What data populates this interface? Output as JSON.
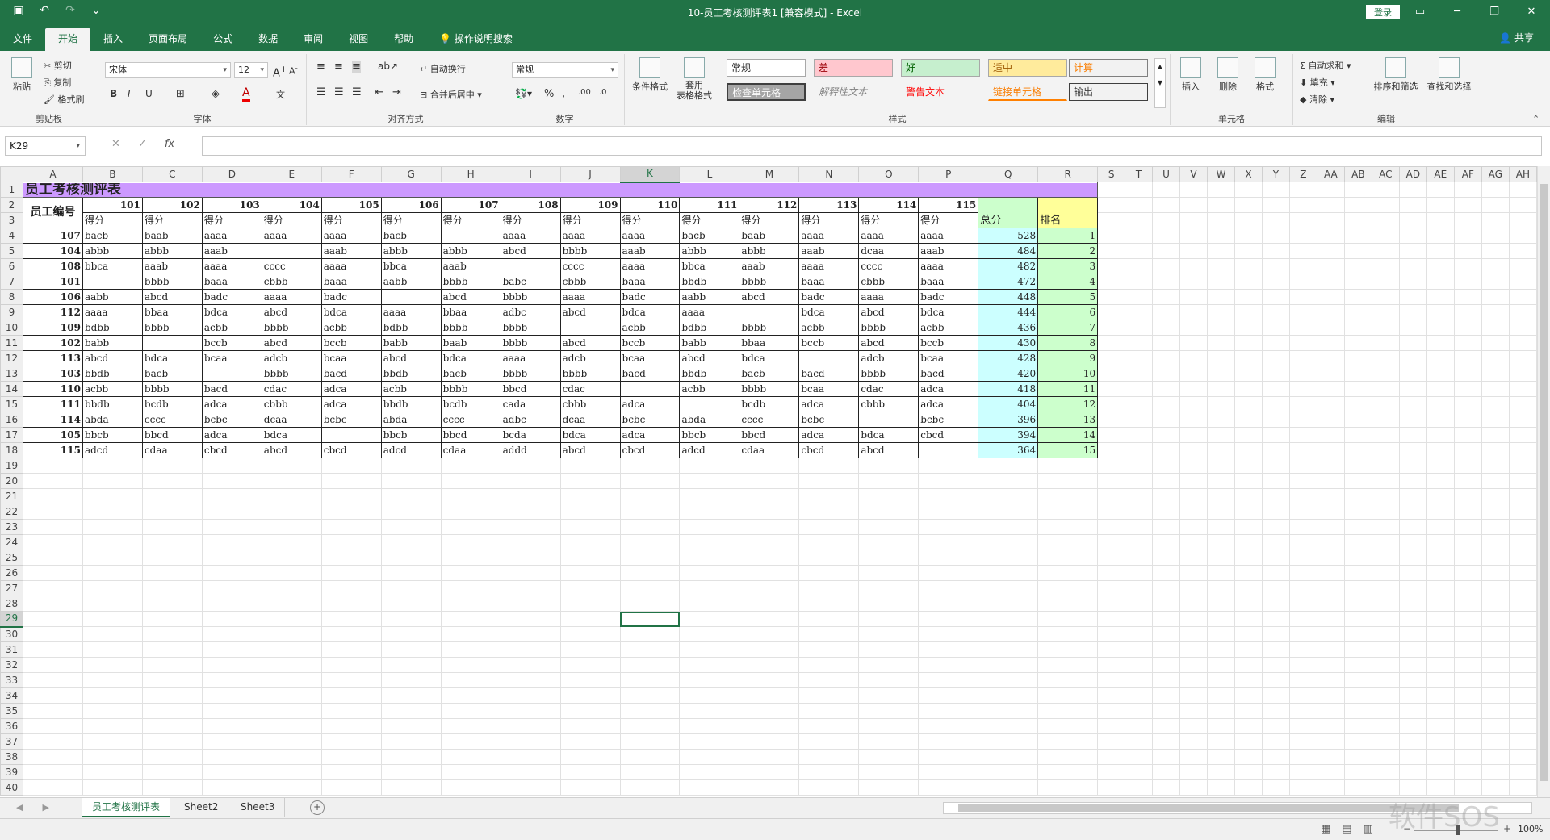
{
  "window": {
    "title": "10-员工考核测评表1  [兼容模式]  -  Excel",
    "login": "登录",
    "share": "共享"
  },
  "ribbon_tabs": [
    "文件",
    "开始",
    "插入",
    "页面布局",
    "公式",
    "数据",
    "审阅",
    "视图",
    "帮助"
  ],
  "tell_me": "操作说明搜索",
  "ribbon": {
    "clipboard": {
      "paste": "粘贴",
      "cut": "剪切",
      "copy": "复制",
      "format_painter": "格式刷",
      "label": "剪贴板"
    },
    "font": {
      "name": "宋体",
      "size": "12",
      "bold": "B",
      "italic": "I",
      "underline": "U",
      "label": "字体"
    },
    "alignment": {
      "wrap": "自动换行",
      "merge": "合并后居中",
      "label": "对齐方式"
    },
    "number": {
      "format": "常规",
      "percent": "%",
      "label": "数字"
    },
    "styles": {
      "conditional": "条件格式",
      "table": "套用\n表格格式",
      "cells": [
        "常规",
        "差",
        "好",
        "适中",
        "计算",
        "检查单元格",
        "解释性文本",
        "警告文本",
        "链接单元格",
        "输出"
      ],
      "label": "样式"
    },
    "cells_group": {
      "insert": "插入",
      "delete": "删除",
      "format": "格式",
      "label": "单元格"
    },
    "editing": {
      "autosum": "自动求和",
      "fill": "填充",
      "clear": "清除",
      "sort": "排序和筛选",
      "find": "查找和选择",
      "label": "编辑"
    }
  },
  "formula_bar": {
    "name_box": "K29",
    "fx": "fx",
    "content": ""
  },
  "columns": [
    "A",
    "B",
    "C",
    "D",
    "E",
    "F",
    "G",
    "H",
    "I",
    "J",
    "K",
    "L",
    "M",
    "N",
    "O",
    "P",
    "Q",
    "R",
    "S",
    "T",
    "U",
    "V",
    "W",
    "X",
    "Y",
    "Z",
    "AA",
    "AB",
    "AC",
    "AD",
    "AE",
    "AF",
    "AG",
    "AH"
  ],
  "sheet": {
    "title": "员工考核测评表",
    "emp_header": "员工编号",
    "project_ids": [
      "101",
      "102",
      "103",
      "104",
      "105",
      "106",
      "107",
      "108",
      "109",
      "110",
      "111",
      "112",
      "113",
      "114",
      "115"
    ],
    "score_label": "得分",
    "total_header": "总分",
    "rank_header": "排名",
    "rows": [
      {
        "id": "107",
        "s": [
          "bacb",
          "baab",
          "aaaa",
          "aaaa",
          "aaaa",
          "bacb",
          "",
          "aaaa",
          "aaaa",
          "aaaa",
          "bacb",
          "baab",
          "aaaa",
          "aaaa",
          "aaaa"
        ],
        "total": "528",
        "rank": "1"
      },
      {
        "id": "104",
        "s": [
          "abbb",
          "abbb",
          "aaab",
          "",
          "aaab",
          "abbb",
          "abbb",
          "abcd",
          "bbbb",
          "aaab",
          "abbb",
          "abbb",
          "aaab",
          "dcaa",
          "aaab"
        ],
        "total": "484",
        "rank": "2"
      },
      {
        "id": "108",
        "s": [
          "bbca",
          "aaab",
          "aaaa",
          "cccc",
          "aaaa",
          "bbca",
          "aaab",
          "",
          "cccc",
          "aaaa",
          "bbca",
          "aaab",
          "aaaa",
          "cccc",
          "aaaa"
        ],
        "total": "482",
        "rank": "3"
      },
      {
        "id": "101",
        "s": [
          "",
          "bbbb",
          "baaa",
          "cbbb",
          "baaa",
          "aabb",
          "bbbb",
          "babc",
          "cbbb",
          "baaa",
          "bbdb",
          "bbbb",
          "baaa",
          "cbbb",
          "baaa"
        ],
        "total": "472",
        "rank": "4"
      },
      {
        "id": "106",
        "s": [
          "aabb",
          "abcd",
          "badc",
          "aaaa",
          "badc",
          "",
          "abcd",
          "bbbb",
          "aaaa",
          "badc",
          "aabb",
          "abcd",
          "badc",
          "aaaa",
          "badc"
        ],
        "total": "448",
        "rank": "5"
      },
      {
        "id": "112",
        "s": [
          "aaaa",
          "bbaa",
          "bdca",
          "abcd",
          "bdca",
          "aaaa",
          "bbaa",
          "adbc",
          "abcd",
          "bdca",
          "aaaa",
          "",
          "bdca",
          "abcd",
          "bdca"
        ],
        "total": "444",
        "rank": "6"
      },
      {
        "id": "109",
        "s": [
          "bdbb",
          "bbbb",
          "acbb",
          "bbbb",
          "acbb",
          "bdbb",
          "bbbb",
          "bbbb",
          "",
          "acbb",
          "bdbb",
          "bbbb",
          "acbb",
          "bbbb",
          "acbb"
        ],
        "total": "436",
        "rank": "7"
      },
      {
        "id": "102",
        "s": [
          "babb",
          "",
          "bccb",
          "abcd",
          "bccb",
          "babb",
          "baab",
          "bbbb",
          "abcd",
          "bccb",
          "babb",
          "bbaa",
          "bccb",
          "abcd",
          "bccb"
        ],
        "total": "430",
        "rank": "8"
      },
      {
        "id": "113",
        "s": [
          "abcd",
          "bdca",
          "bcaa",
          "adcb",
          "bcaa",
          "abcd",
          "bdca",
          "aaaa",
          "adcb",
          "bcaa",
          "abcd",
          "bdca",
          "",
          "adcb",
          "bcaa"
        ],
        "total": "428",
        "rank": "9"
      },
      {
        "id": "103",
        "s": [
          "bbdb",
          "bacb",
          "",
          "bbbb",
          "bacd",
          "bbdb",
          "bacb",
          "bbbb",
          "bbbb",
          "bacd",
          "bbdb",
          "bacb",
          "bacd",
          "bbbb",
          "bacd"
        ],
        "total": "420",
        "rank": "10"
      },
      {
        "id": "110",
        "s": [
          "acbb",
          "bbbb",
          "bacd",
          "cdac",
          "adca",
          "acbb",
          "bbbb",
          "bbcd",
          "cdac",
          "",
          "acbb",
          "bbbb",
          "bcaa",
          "cdac",
          "adca"
        ],
        "total": "418",
        "rank": "11"
      },
      {
        "id": "111",
        "s": [
          "bbdb",
          "bcdb",
          "adca",
          "cbbb",
          "adca",
          "bbdb",
          "bcdb",
          "cada",
          "cbbb",
          "adca",
          "",
          "bcdb",
          "adca",
          "cbbb",
          "adca"
        ],
        "total": "404",
        "rank": "12"
      },
      {
        "id": "114",
        "s": [
          "abda",
          "cccc",
          "bcbc",
          "dcaa",
          "bcbc",
          "abda",
          "cccc",
          "adbc",
          "dcaa",
          "bcbc",
          "abda",
          "cccc",
          "bcbc",
          "",
          "bcbc"
        ],
        "total": "396",
        "rank": "13"
      },
      {
        "id": "105",
        "s": [
          "bbcb",
          "bbcd",
          "adca",
          "bdca",
          "",
          "bbcb",
          "bbcd",
          "bcda",
          "bdca",
          "adca",
          "bbcb",
          "bbcd",
          "adca",
          "bdca",
          "cbcd"
        ],
        "total": "394",
        "rank": "14"
      },
      {
        "id": "115",
        "s": [
          "adcd",
          "cdaa",
          "cbcd",
          "abcd",
          "cbcd",
          "adcd",
          "cdaa",
          "addd",
          "abcd",
          "cbcd",
          "adcd",
          "cdaa",
          "cbcd",
          "abcd",
          ""
        ],
        "total": "364",
        "rank": "15"
      }
    ]
  },
  "sheet_tabs": [
    "员工考核测评表",
    "Sheet2",
    "Sheet3"
  ],
  "status": {
    "zoom": "100%"
  },
  "watermark": "软件SOS",
  "colors": {
    "accent": "#217346",
    "title_fill": "#cc99ff",
    "total_fill": "#ccffcc",
    "rank_fill": "#ffff99",
    "total_values_fill": "#ccffff"
  }
}
